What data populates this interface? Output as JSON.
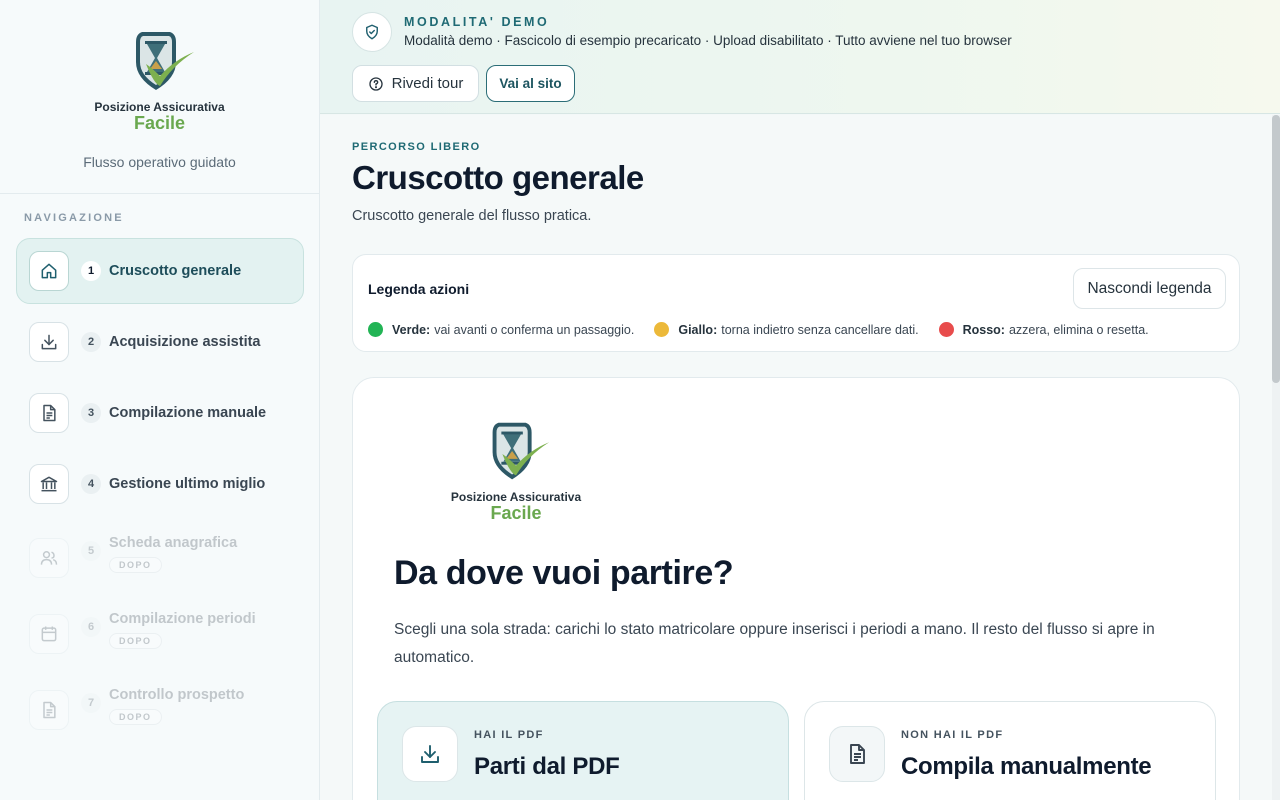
{
  "brand": {
    "logo_line1": "Posizione Assicurativa",
    "logo_line2": "Facile",
    "subtitle": "Flusso operativo guidato"
  },
  "sidebar": {
    "section_title": "NAVIGAZIONE",
    "items": [
      {
        "num": "1",
        "label": "Cruscotto generale",
        "icon": "home-icon",
        "active": true
      },
      {
        "num": "2",
        "label": "Acquisizione assistita",
        "icon": "download-icon"
      },
      {
        "num": "3",
        "label": "Compilazione manuale",
        "icon": "document-icon"
      },
      {
        "num": "4",
        "label": "Gestione ultimo miglio",
        "icon": "bank-icon"
      },
      {
        "num": "5",
        "label": "Scheda anagrafica",
        "icon": "users-icon",
        "badge": "DOPO",
        "locked": true
      },
      {
        "num": "6",
        "label": "Compilazione periodi",
        "icon": "calendar-icon",
        "badge": "DOPO",
        "locked": true
      },
      {
        "num": "7",
        "label": "Controllo prospetto",
        "icon": "document-icon",
        "badge": "DOPO",
        "locked": true
      }
    ]
  },
  "banner": {
    "title": "MODALITA' DEMO",
    "text": "Modalità demo · Fascicolo di esempio precaricato · Upload disabilitato · Tutto avviene nel tuo browser",
    "tour_label": "Rivedi tour",
    "site_label": "Vai al sito",
    "icon": "shield-check-icon"
  },
  "page": {
    "eyebrow": "PERCORSO LIBERO",
    "title": "Cruscotto generale",
    "subtitle": "Cruscotto generale del flusso pratica."
  },
  "legend": {
    "title": "Legenda azioni",
    "toggle_label": "Nascondi legenda",
    "items": [
      {
        "name": "Verde:",
        "text": "vai avanti o conferma un passaggio.",
        "color": "#22b455"
      },
      {
        "name": "Giallo:",
        "text": "torna indietro senza cancellare dati.",
        "color": "#ecb93a"
      },
      {
        "name": "Rosso:",
        "text": "azzera, elimina o resetta.",
        "color": "#e84c4c"
      }
    ]
  },
  "start": {
    "title": "Da dove vuoi partire?",
    "text": "Scegli una sola strada: carichi lo stato matricolare oppure inserisci i periodi a mano. Il resto del flusso si apre in automatico.",
    "choices": [
      {
        "eyebrow": "HAI IL PDF",
        "title": "Parti dal PDF",
        "icon": "download-icon"
      },
      {
        "eyebrow": "NON HAI IL PDF",
        "title": "Compila manualmente",
        "icon": "document-icon"
      }
    ]
  },
  "colors": {
    "accent": "#1f6a74",
    "logo_green": "#6aa84f"
  }
}
